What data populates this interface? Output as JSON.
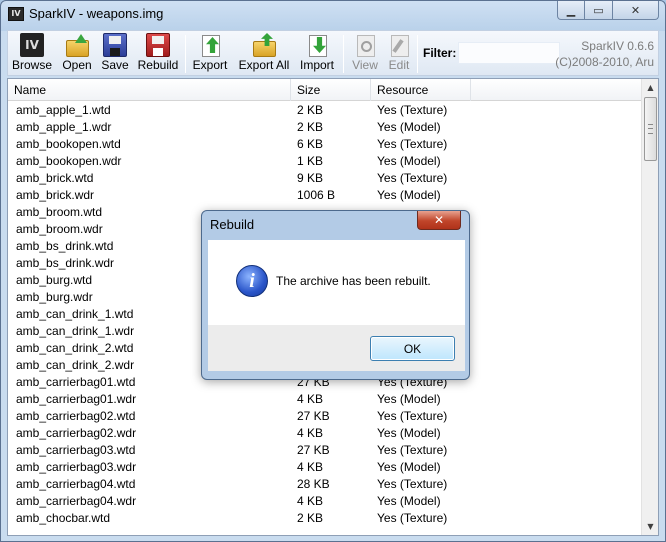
{
  "window": {
    "title": "SparkIV - weapons.img",
    "icon_text": "IV",
    "minimize_glyph": "▁",
    "maximize_glyph": "▭",
    "close_glyph": "✕"
  },
  "toolbar": {
    "browse_icon_text": "IV",
    "browse": "Browse",
    "open": "Open",
    "save": "Save",
    "rebuild": "Rebuild",
    "export": "Export",
    "export_all": "Export All",
    "import": "Import",
    "view": "View",
    "edit": "Edit",
    "filter_label": "Filter:",
    "filter_value": "",
    "version_line1": "SparkIV 0.6.6",
    "version_line2": "(C)2008-2010, Aru"
  },
  "list": {
    "columns": [
      "Name",
      "Size",
      "Resource"
    ],
    "rows": [
      {
        "name": "amb_apple_1.wtd",
        "size": "2 KB",
        "resource": "Yes (Texture)"
      },
      {
        "name": "amb_apple_1.wdr",
        "size": "2 KB",
        "resource": "Yes (Model)"
      },
      {
        "name": "amb_bookopen.wtd",
        "size": "6 KB",
        "resource": "Yes (Texture)"
      },
      {
        "name": "amb_bookopen.wdr",
        "size": "1 KB",
        "resource": "Yes (Model)"
      },
      {
        "name": "amb_brick.wtd",
        "size": "9 KB",
        "resource": "Yes (Texture)"
      },
      {
        "name": "amb_brick.wdr",
        "size": "1006 B",
        "resource": "Yes (Model)"
      },
      {
        "name": "amb_broom.wtd",
        "size": "",
        "resource": ""
      },
      {
        "name": "amb_broom.wdr",
        "size": "",
        "resource": ""
      },
      {
        "name": "amb_bs_drink.wtd",
        "size": "",
        "resource": ""
      },
      {
        "name": "amb_bs_drink.wdr",
        "size": "",
        "resource": ""
      },
      {
        "name": "amb_burg.wtd",
        "size": "",
        "resource": ""
      },
      {
        "name": "amb_burg.wdr",
        "size": "",
        "resource": ""
      },
      {
        "name": "amb_can_drink_1.wtd",
        "size": "",
        "resource": ""
      },
      {
        "name": "amb_can_drink_1.wdr",
        "size": "",
        "resource": ""
      },
      {
        "name": "amb_can_drink_2.wtd",
        "size": "",
        "resource": ""
      },
      {
        "name": "amb_can_drink_2.wdr",
        "size": "",
        "resource": ""
      },
      {
        "name": "amb_carrierbag01.wtd",
        "size": "27 KB",
        "resource": "Yes (Texture)"
      },
      {
        "name": "amb_carrierbag01.wdr",
        "size": "4 KB",
        "resource": "Yes (Model)"
      },
      {
        "name": "amb_carrierbag02.wtd",
        "size": "27 KB",
        "resource": "Yes (Texture)"
      },
      {
        "name": "amb_carrierbag02.wdr",
        "size": "4 KB",
        "resource": "Yes (Model)"
      },
      {
        "name": "amb_carrierbag03.wtd",
        "size": "27 KB",
        "resource": "Yes (Texture)"
      },
      {
        "name": "amb_carrierbag03.wdr",
        "size": "4 KB",
        "resource": "Yes (Model)"
      },
      {
        "name": "amb_carrierbag04.wtd",
        "size": "28 KB",
        "resource": "Yes (Texture)"
      },
      {
        "name": "amb_carrierbag04.wdr",
        "size": "4 KB",
        "resource": "Yes (Model)"
      },
      {
        "name": "amb_chocbar.wtd",
        "size": "2 KB",
        "resource": "Yes (Texture)"
      }
    ]
  },
  "scrollbar": {
    "up_glyph": "▲",
    "down_glyph": "▼"
  },
  "dialog": {
    "title": "Rebuild",
    "close_glyph": "✕",
    "icon_glyph": "i",
    "message": "The archive has been rebuilt.",
    "ok": "OK"
  }
}
